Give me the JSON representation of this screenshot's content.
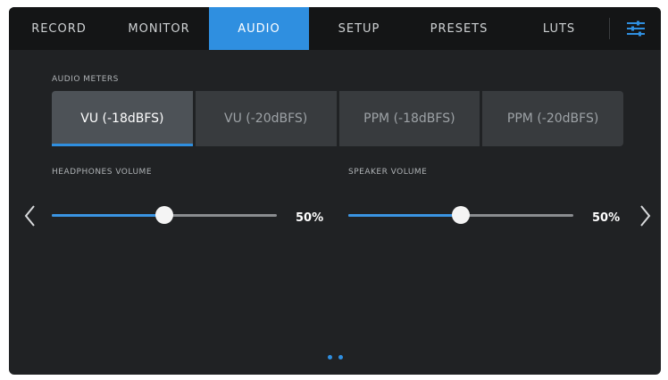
{
  "tabs": [
    {
      "label": "RECORD",
      "active": false
    },
    {
      "label": "MONITOR",
      "active": false
    },
    {
      "label": "AUDIO",
      "active": true
    },
    {
      "label": "SETUP",
      "active": false
    },
    {
      "label": "PRESETS",
      "active": false
    },
    {
      "label": "LUTS",
      "active": false
    }
  ],
  "settings_icon": "sliders-icon",
  "audio_meters": {
    "label": "AUDIO METERS",
    "options": [
      "VU (-18dBFS)",
      "VU (-20dBFS)",
      "PPM (-18dBFS)",
      "PPM (-20dBFS)"
    ],
    "selected": "VU (-18dBFS)"
  },
  "headphones": {
    "label": "HEADPHONES VOLUME",
    "value_text": "50%",
    "level": 0.5
  },
  "speaker": {
    "label": "SPEAKER VOLUME",
    "value_text": "50%",
    "level": 0.5
  },
  "nav": {
    "prev_icon": "chevron-left-icon",
    "next_icon": "chevron-right-icon"
  },
  "pager": {
    "pages": 2,
    "current": 1
  },
  "colors": {
    "accent": "#2f8fe0",
    "background": "#202224",
    "tabbar": "#141516"
  }
}
